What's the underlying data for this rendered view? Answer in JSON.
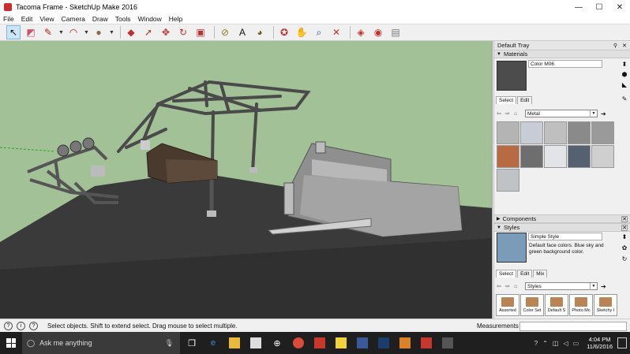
{
  "window": {
    "title": "Tacoma Frame - SketchUp Make 2016",
    "controls": {
      "minimize": "—",
      "maximize": "☐",
      "close": "✕"
    }
  },
  "menu": [
    "File",
    "Edit",
    "View",
    "Camera",
    "Draw",
    "Tools",
    "Window",
    "Help"
  ],
  "toolbar": {
    "tools": [
      {
        "name": "select-tool",
        "glyph": "↖"
      },
      {
        "name": "eraser-tool",
        "glyph": "◩"
      },
      {
        "name": "pencil-tool",
        "glyph": "✎"
      },
      {
        "name": "arc-tool",
        "glyph": "◠"
      },
      {
        "name": "shape-tool",
        "glyph": "●"
      },
      {
        "name": "push-pull-tool",
        "glyph": "◆"
      },
      {
        "name": "follow-me-tool",
        "glyph": "➚"
      },
      {
        "name": "move-tool",
        "glyph": "✥"
      },
      {
        "name": "rotate-tool",
        "glyph": "↻"
      },
      {
        "name": "offset-tool",
        "glyph": "▣"
      },
      {
        "name": "tape-measure-tool",
        "glyph": "⊘"
      },
      {
        "name": "text-tool",
        "glyph": "A"
      },
      {
        "name": "paint-bucket-tool",
        "glyph": "◕"
      },
      {
        "name": "orbit-tool",
        "glyph": "✪"
      },
      {
        "name": "pan-tool",
        "glyph": "✋"
      },
      {
        "name": "zoom-tool",
        "glyph": "⌕"
      },
      {
        "name": "zoom-extents-tool",
        "glyph": "✕"
      },
      {
        "name": "warehouse-tool",
        "glyph": "◈"
      },
      {
        "name": "extension-warehouse-tool",
        "glyph": "◉"
      },
      {
        "name": "send-to-layout-tool",
        "glyph": "▤"
      }
    ]
  },
  "tray": {
    "title": "Default Tray",
    "materials": {
      "header": "Materials",
      "current": "Color M06",
      "tabs": [
        "Select",
        "Edit"
      ],
      "collection": "Metal",
      "swatch_colors": [
        "#b4b4b4",
        "#c8ccd4",
        "#bfbfbf",
        "#8a8a8a",
        "#9a9a9a",
        "#b86a42",
        "#6e6e6e",
        "#e2e4e8",
        "#556070",
        "#cfcfcf",
        "#c0c3c6"
      ]
    },
    "components": {
      "header": "Components"
    },
    "styles": {
      "header": "Styles",
      "current": "Simple Style",
      "description": "Default face colors. Blue sky and green background color.",
      "tabs": [
        "Select",
        "Edit",
        "Mix"
      ],
      "collection": "Styles",
      "cards": [
        "Assorted",
        "Color Set",
        "Default S",
        "Photo Mc",
        "Sketchy I"
      ]
    }
  },
  "status": {
    "hint": "Select objects. Shift to extend select. Drag mouse to select multiple.",
    "measurements_label": "Measurements"
  },
  "taskbar": {
    "search_placeholder": "Ask me anything",
    "time": "4:04 PM",
    "date": "11/6/2016"
  }
}
